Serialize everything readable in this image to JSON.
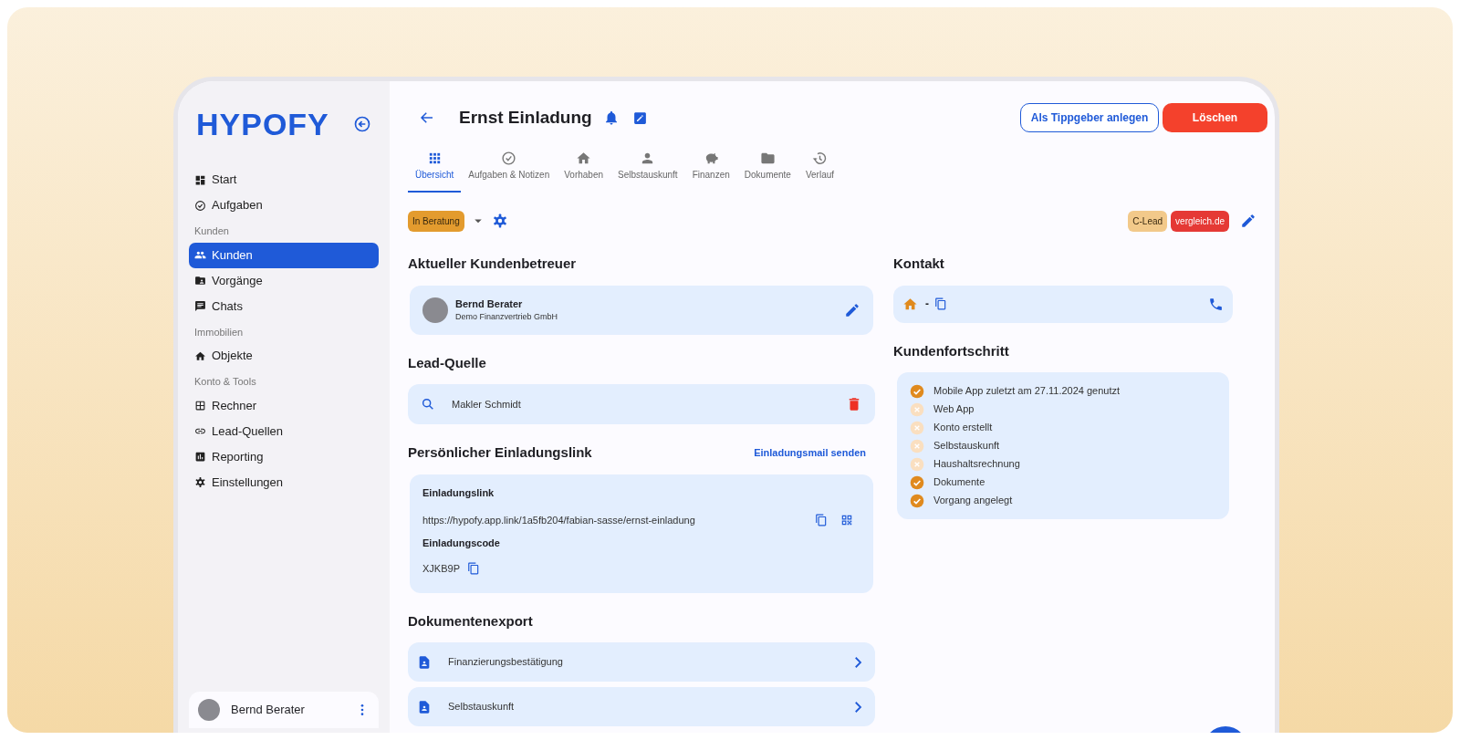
{
  "sidebar": {
    "logo": "HYPOFY",
    "nav": [
      {
        "kind": "item",
        "label": "Start",
        "selected": false
      },
      {
        "kind": "item",
        "label": "Aufgaben",
        "selected": false
      },
      {
        "kind": "section",
        "label": "Kunden"
      },
      {
        "kind": "item",
        "label": "Kunden",
        "selected": true
      },
      {
        "kind": "item",
        "label": "Vorgänge",
        "selected": false
      },
      {
        "kind": "item",
        "label": "Chats",
        "selected": false
      },
      {
        "kind": "section",
        "label": "Immobilien"
      },
      {
        "kind": "item",
        "label": "Objekte",
        "selected": false
      },
      {
        "kind": "section",
        "label": "Konto & Tools"
      },
      {
        "kind": "item",
        "label": "Rechner",
        "selected": false
      },
      {
        "kind": "item",
        "label": "Lead-Quellen",
        "selected": false
      },
      {
        "kind": "item",
        "label": "Reporting",
        "selected": false
      },
      {
        "kind": "item",
        "label": "Einstellungen",
        "selected": false
      }
    ],
    "user": {
      "name": "Bernd Berater"
    }
  },
  "header": {
    "title": "Ernst Einladung",
    "buttons": [
      {
        "kind": "outline",
        "label": "Als Tippgeber anlegen"
      },
      {
        "kind": "danger",
        "label": "Löschen"
      }
    ]
  },
  "tabs": [
    {
      "label": "Übersicht",
      "selected": true
    },
    {
      "label": "Aufgaben & Notizen",
      "selected": false
    },
    {
      "label": "Vorhaben",
      "selected": false
    },
    {
      "label": "Selbstauskunft",
      "selected": false
    },
    {
      "label": "Finanzen",
      "selected": false
    },
    {
      "label": "Dokumente",
      "selected": false
    },
    {
      "label": "Verlauf",
      "selected": false
    }
  ],
  "status": {
    "label": "In Beratung",
    "tags": [
      {
        "label": "C-Lead",
        "color": "#f2c98a"
      },
      {
        "label": "vergleich.de",
        "color": "#e53935"
      }
    ]
  },
  "advisor": {
    "heading": "Aktueller Kundenbetreuer",
    "name": "Bernd Berater",
    "company": "Demo Finanzvertrieb GmbH"
  },
  "lead_source": {
    "heading": "Lead-Quelle",
    "value": "Makler Schmidt"
  },
  "invitation": {
    "heading": "Persönlicher Einladungslink",
    "action": "Einladungsmail senden",
    "link_label": "Einladungslink",
    "link": "https://hypofy.app.link/1a5fb204/fabian-sasse/ernst-einladung",
    "code_label": "Einladungscode",
    "code": "XJKB9P"
  },
  "export": {
    "heading": "Dokumentenexport",
    "items": [
      "Finanzierungsbestätigung",
      "Selbstauskunft"
    ]
  },
  "contact": {
    "heading": "Kontakt",
    "value": "-"
  },
  "progress": {
    "heading": "Kundenfortschritt",
    "items": [
      {
        "label": "Mobile App zuletzt am 27.11.2024 genutzt",
        "done": true
      },
      {
        "label": "Web App",
        "done": false
      },
      {
        "label": "Konto erstellt",
        "done": false
      },
      {
        "label": "Selbstauskunft",
        "done": false
      },
      {
        "label": "Haushaltsrechnung",
        "done": false
      },
      {
        "label": "Dokumente",
        "done": true
      },
      {
        "label": "Vorgang angelegt",
        "done": true
      }
    ]
  }
}
